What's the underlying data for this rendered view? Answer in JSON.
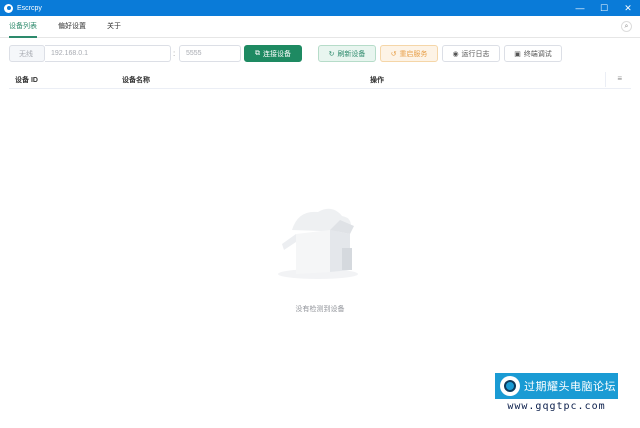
{
  "window": {
    "title": "Escrcpy",
    "minimize": "—",
    "maximize": "☐",
    "close": "✕"
  },
  "tabs": [
    {
      "label": "设备列表",
      "active": true
    },
    {
      "label": "偏好设置",
      "active": false
    },
    {
      "label": "关于",
      "active": false
    }
  ],
  "toolbar": {
    "mode": "无线",
    "ip_placeholder": "192.168.0.1",
    "separator": ":",
    "port_placeholder": "5555",
    "connect_label": "连接设备",
    "refresh_label": "刷新设备",
    "restart_label": "重启服务",
    "logs_label": "运行日志",
    "terminal_label": "终端调试"
  },
  "table": {
    "columns": [
      "设备 ID",
      "设备名称",
      "操作"
    ],
    "rows": [],
    "empty_text": "没有检测到设备"
  },
  "icons": {
    "connect": "link-icon",
    "refresh": "refresh-icon",
    "restart": "restart-icon",
    "logs": "eye-icon",
    "terminal": "terminal-icon",
    "column_settings": "menu-icon",
    "search": "search-icon"
  },
  "watermark": {
    "name": "过期耀头电脑论坛",
    "url": "www.gqgtpc.com"
  },
  "colors": {
    "titlebar": "#0a7bd8",
    "accent": "#1e8a62",
    "refresh_bg": "#e8f5ef",
    "restart_bg": "#fdf3e6",
    "watermark_bg": "#1a9bd4"
  }
}
